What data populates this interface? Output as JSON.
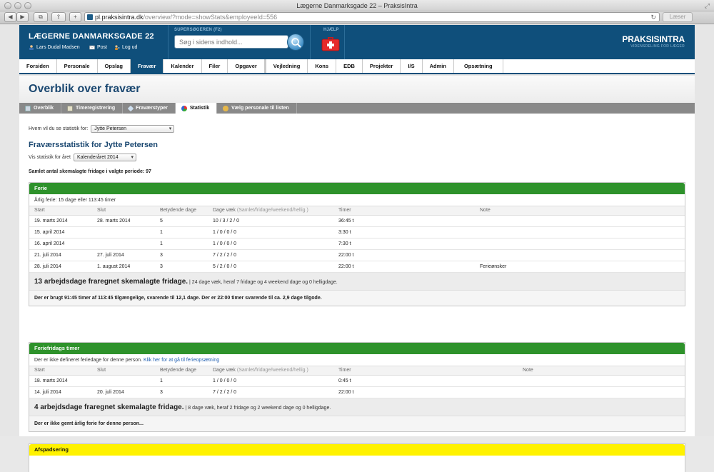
{
  "browser": {
    "window_title": "Lægerne Danmarksgade 22 – PraksisIntra",
    "url_host": "pl.praksisintra.dk",
    "url_path": "/overview/?mode=showStats&employeeId=556",
    "reader_label": "Læser"
  },
  "header": {
    "clinic_name": "LÆGERNE DANMARKSGADE 22",
    "user_name": "Lars Dudal Madsen",
    "mail_label": "Post",
    "logout_label": "Log ud",
    "search_label": "SUPERSØGEREN (F2)",
    "search_placeholder": "Søg i sidens indhold...",
    "help_label": "HJÆLP",
    "brand_name": "PRAKSISINTRA",
    "brand_tagline": "VIDENSDELING FOR LÆGER"
  },
  "nav": {
    "items": [
      "Forsiden",
      "Personale",
      "Opslag",
      "Fravær",
      "Kalender",
      "Filer",
      "Opgaver",
      "Vejledning",
      "Kons",
      "EDB",
      "Projekter",
      "I/S",
      "Admin",
      "Opsætning"
    ],
    "active": "Fravær"
  },
  "page": {
    "title": "Overblik over fravær",
    "subtabs": [
      "Overblik",
      "Timeregistrering",
      "Fraværstyper",
      "Statistik",
      "Vælg personale til listen"
    ],
    "active_subtab": "Statistik",
    "who_label": "Hvem vil du se statistik for:",
    "who_value": "Jytte Petersen",
    "stats_title": "Fraværsstatistik for Jytte Petersen",
    "year_label": "Vis statistik for året",
    "year_value": "Kalenderåret 2014",
    "total_line": "Samlet antal skemalagte fridage i valgte periode: 97"
  },
  "columns": {
    "start": "Start",
    "slut": "Slut",
    "betydende": "Betydende dage",
    "dage_vaek": "Dage væk",
    "dage_vaek_sub": "(Samlet/fridage/weekend/hellig.)",
    "timer": "Timer",
    "note": "Note"
  },
  "sections": {
    "ferie": {
      "title": "Ferie",
      "color": "#2e922b",
      "info": "Årlig ferie: 15 dage eller 113:45 timer",
      "rows": [
        [
          "19. marts 2014",
          "28. marts 2014",
          "5",
          "10 / 3 / 2 / 0",
          "36:45 t",
          ""
        ],
        [
          "15. april 2014",
          "",
          "1",
          "1 / 0 / 0 / 0",
          "3:30 t",
          ""
        ],
        [
          "16. april 2014",
          "",
          "1",
          "1 / 0 / 0 / 0",
          "7:30 t",
          ""
        ],
        [
          "21. juli 2014",
          "27. juli 2014",
          "3",
          "7 / 2 / 2 / 0",
          "22:00 t",
          ""
        ],
        [
          "28. juli 2014",
          "1. august 2014",
          "3",
          "5 / 2 / 0 / 0",
          "22:00 t",
          "Ferieønsker"
        ]
      ],
      "summary_big": "13 arbejdsdage fraregnet skemalagte fridage.",
      "summary_small": "| 24 dage væk, heraf 7 fridage og 4 weekend dage og 0 helligdage.",
      "footer": "Der er brugt 91:45 timer af 113:45 tilgængelige, svarende til 12,1 dage. Der er 22:00 timer svarende til ca. 2,9 dage tilgode."
    },
    "feriefridage": {
      "title": "Feriefridags timer",
      "color": "#2e922b",
      "info_text": "Der er ikke defineret feriedage for denne person.",
      "info_link": "Klik her for at gå til ferieopsætning",
      "rows": [
        [
          "18. marts 2014",
          "",
          "1",
          "1 / 0 / 0 / 0",
          "0:45 t",
          ""
        ],
        [
          "14. juli 2014",
          "20. juli 2014",
          "3",
          "7 / 2 / 2 / 0",
          "22:00 t",
          ""
        ]
      ],
      "summary_big": "4 arbejdsdage fraregnet skemalagte fridage.",
      "summary_small": "| 8 dage væk, heraf 2 fridage og 2 weekend dage og 0 helligdage.",
      "footer": "Der er ikke gemt årlig ferie for denne person..."
    },
    "afspadsering": {
      "title": "Afspadsering",
      "color": "#fff200"
    }
  }
}
